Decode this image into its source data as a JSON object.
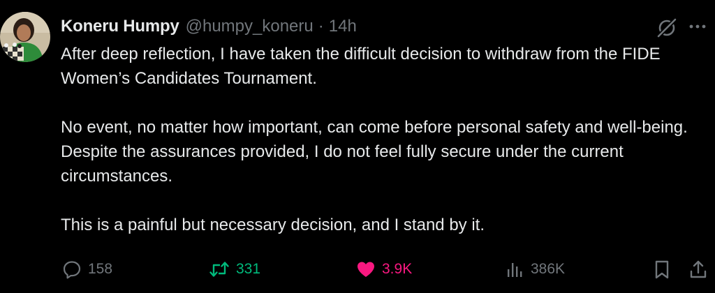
{
  "author": {
    "name": "Koneru Humpy",
    "handle": "@humpy_koneru",
    "separator": "·",
    "timestamp": "14h"
  },
  "tweet": {
    "paragraphs": [
      "After deep reflection, I have taken the difficult decision to withdraw from the FIDE Women’s Candidates Tournament.",
      "No event, no matter how important, can come before personal safety and well-being. Despite the assurances provided, I do not feel fully secure under the current circumstances.",
      "This is a painful but necessary decision, and I stand by it."
    ]
  },
  "actions": {
    "replies": "158",
    "reposts": "331",
    "likes": "3.9K",
    "views": "386K"
  },
  "colors": {
    "background": "#000000",
    "primary_text": "#e7e9ea",
    "secondary_text": "#71767b",
    "repost_active": "#00ba7c",
    "like_active": "#f91880"
  },
  "icons": {
    "reply": "reply-icon",
    "repost": "repost-icon",
    "like": "heart-icon",
    "views": "views-icon",
    "bookmark": "bookmark-icon",
    "share": "share-icon",
    "grok": "grok-icon",
    "more": "more-icon"
  }
}
